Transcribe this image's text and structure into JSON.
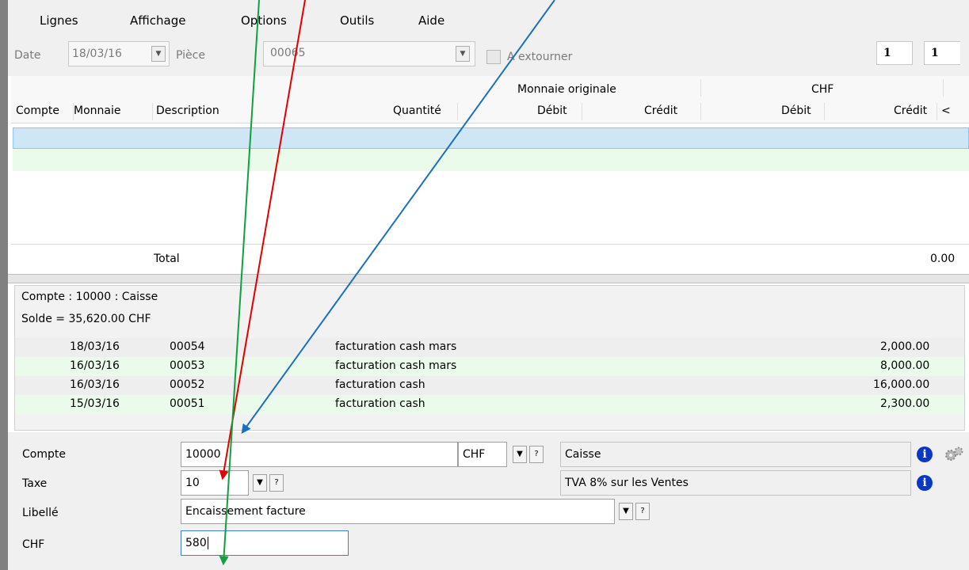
{
  "menu": [
    "Lignes",
    "Affichage",
    "Options",
    "Outils",
    "Aide"
  ],
  "toolbar": {
    "date_label": "Date",
    "date_value": "18/03/16",
    "piece_label": "Pièce",
    "piece_value": "00065",
    "extourner_label": "A extourner",
    "page_current": "1",
    "page_total": "1"
  },
  "grid": {
    "group_original": "Monnaie originale",
    "group_chf": "CHF",
    "columns": {
      "compte": "Compte",
      "monnaie": "Monnaie",
      "description": "Description",
      "quantite": "Quantité",
      "debit_orig": "Débit",
      "credit_orig": "Crédit",
      "debit_chf": "Débit",
      "credit_chf": "Crédit",
      "more": "<"
    },
    "total_label": "Total",
    "total_value": "0.00"
  },
  "account_info": {
    "compte_line": "Compte : 10000 : Caisse",
    "solde_line": "Solde = 35,620.00  CHF",
    "history": [
      {
        "date": "18/03/16",
        "piece": "00054",
        "description": "facturation cash mars",
        "amount": "2,000.00"
      },
      {
        "date": "16/03/16",
        "piece": "00053",
        "description": "facturation cash mars",
        "amount": "8,000.00"
      },
      {
        "date": "16/03/16",
        "piece": "00052",
        "description": "facturation cash",
        "amount": "16,000.00"
      },
      {
        "date": "15/03/16",
        "piece": "00051",
        "description": "facturation cash",
        "amount": "2,300.00"
      }
    ]
  },
  "form": {
    "compte_label": "Compte",
    "compte_value": "10000",
    "currency_value": "CHF",
    "help_symbol": "?",
    "account_name": "Caisse",
    "taxe_label": "Taxe",
    "taxe_value": "10",
    "taxe_name": "TVA 8% sur les Ventes",
    "libelle_label": "Libellé",
    "libelle_value": "Encaissement facture",
    "chf_label": "CHF",
    "chf_value": "580"
  },
  "arrow_colors": {
    "blue": "#1b6fc0",
    "red": "#e00000",
    "green": "#10a040"
  }
}
